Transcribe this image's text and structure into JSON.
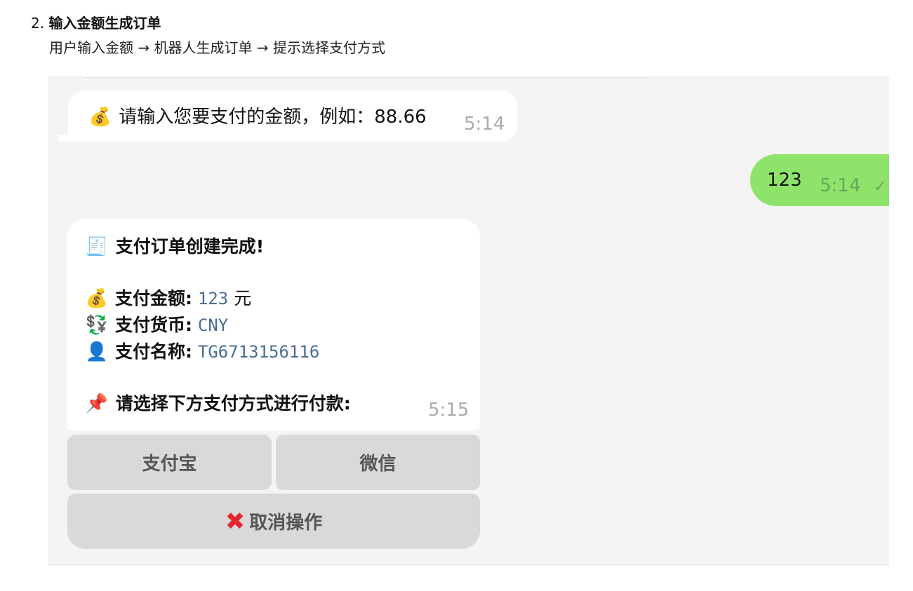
{
  "step": {
    "number": "2.",
    "title": "输入金额生成订单",
    "description": "用户输入金额 → 机器人生成订单 → 提示选择支付方式"
  },
  "chat": {
    "bot_prompt": {
      "emoji": "💰",
      "text": "请输入您要支付的金额，例如：88.66",
      "time": "5:14"
    },
    "user_message": {
      "text": "123",
      "time": "5:14",
      "status": "✓"
    },
    "order_message": {
      "title_emoji": "🧾",
      "title": "支付订单创建完成!",
      "amount_emoji": "💰",
      "amount_label": "支付金额:",
      "amount_value": "123",
      "amount_unit": "元",
      "currency_emoji": "💱",
      "currency_label": "支付货币:",
      "currency_value": "CNY",
      "name_emoji": "👤",
      "name_label": "支付名称:",
      "name_value": "TG6713156116",
      "prompt_emoji": "📌",
      "prompt": "请选择下方支付方式进行付款:",
      "time": "5:15"
    },
    "keyboard": {
      "alipay": "支付宝",
      "wechat": "微信",
      "cancel_icon": "✖",
      "cancel": "取消操作"
    }
  }
}
